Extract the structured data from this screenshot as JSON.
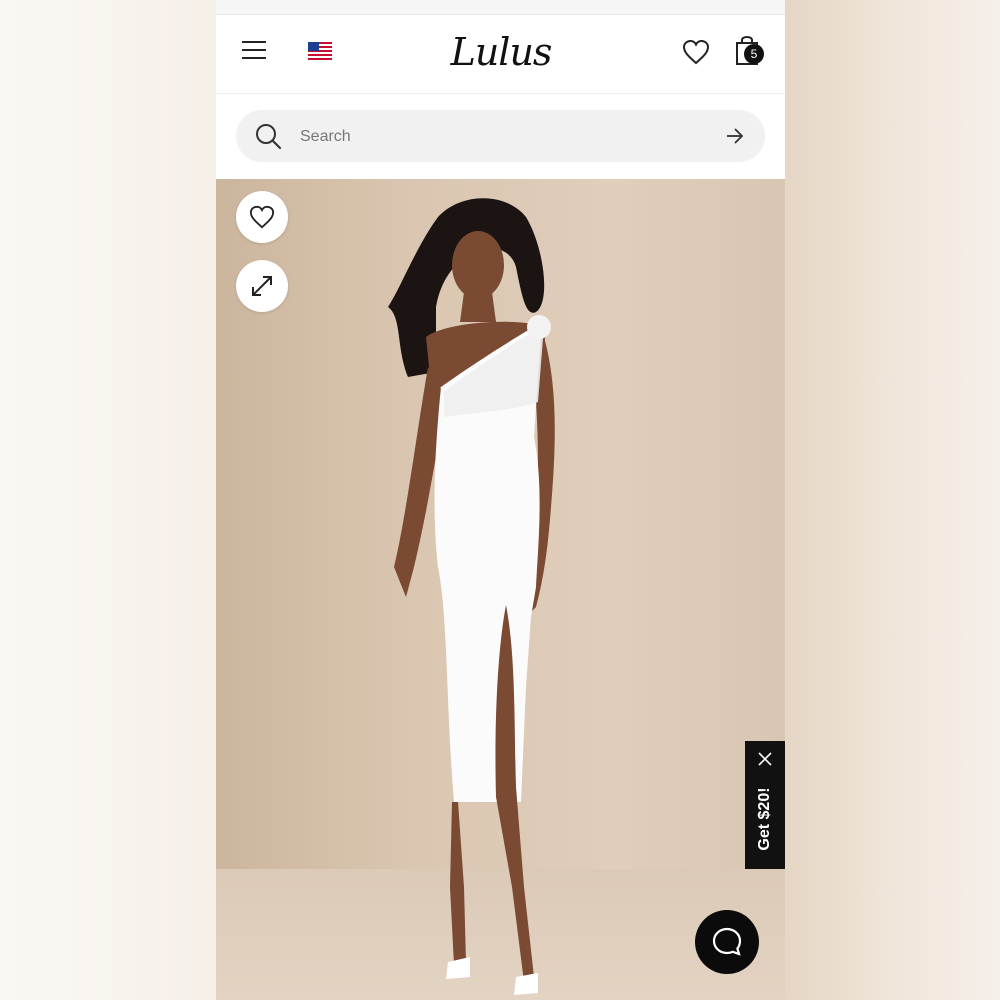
{
  "app": {
    "brand": "Lulus"
  },
  "header": {
    "menu_icon": "hamburger-menu-icon",
    "flag_icon": "us-flag-icon",
    "logo_text": "Lulus",
    "wishlist_icon": "heart-icon",
    "bag_icon": "shopping-bag-icon",
    "bag_count": "5"
  },
  "search": {
    "placeholder": "Search",
    "icon": "search-icon",
    "submit_icon": "arrow-right-icon"
  },
  "product_image": {
    "description_icon_buttons": [
      "heart-icon",
      "expand-icon"
    ],
    "colors": {
      "background": "#dac6b1",
      "dress": "#ffffff"
    }
  },
  "promo": {
    "label": "Get $20!",
    "close_icon": "close-icon"
  },
  "chat": {
    "icon": "chat-bubble-icon"
  }
}
